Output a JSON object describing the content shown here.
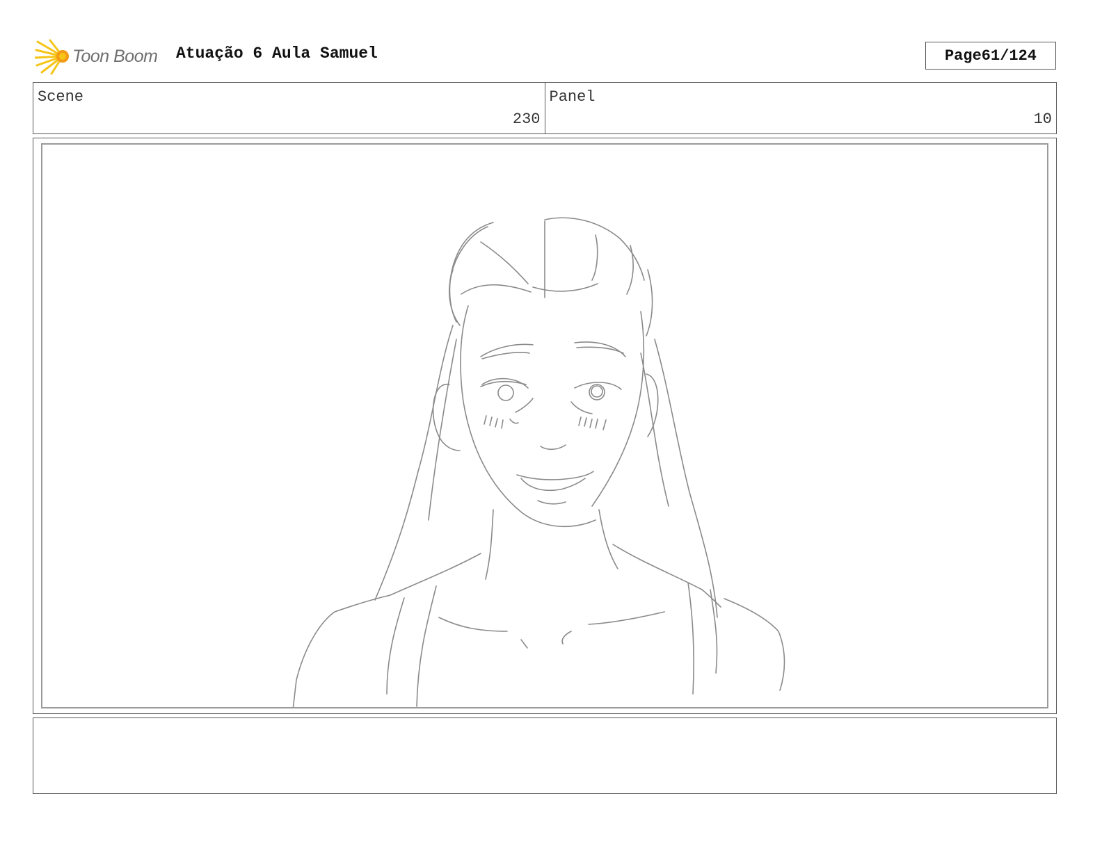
{
  "header": {
    "logo_text": "Toon Boom",
    "logo_icon": "toon-boom-star-burst",
    "title": "Atuação 6 Aula Samuel",
    "page_label": "Page",
    "page_value": "61/124"
  },
  "info": {
    "scene_label": "Scene",
    "scene_value": "230",
    "panel_label": "Panel",
    "panel_value": "10"
  },
  "panel": {
    "drawing": "pencil-sketch-smiling-girl-long-hair"
  },
  "notes": {
    "text": ""
  },
  "colors": {
    "logo_yellow": "#f6c417",
    "logo_orange": "#f39a16",
    "sketch_stroke": "#8a8a8a",
    "border": "#555555"
  }
}
